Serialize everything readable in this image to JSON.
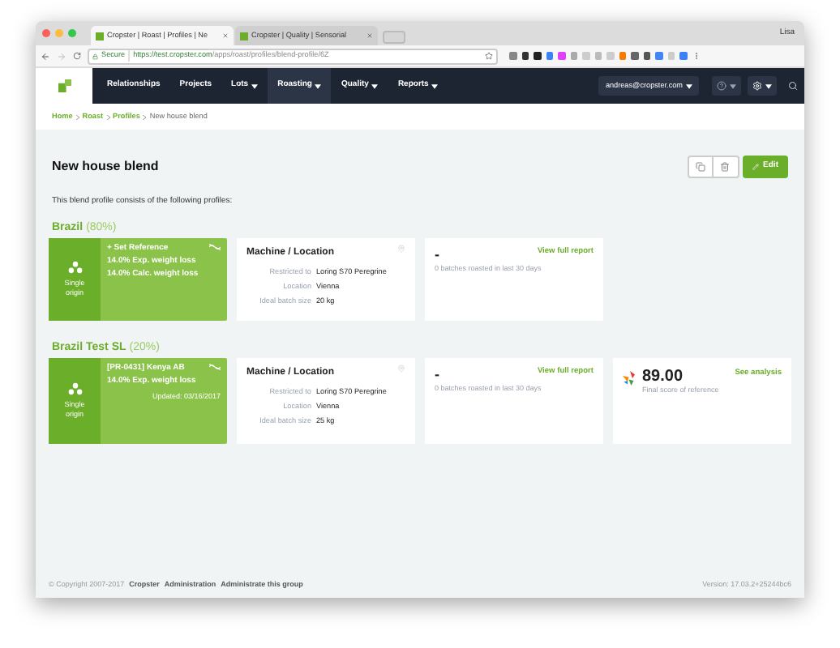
{
  "browser": {
    "tabs": [
      {
        "title": "Cropster | Roast | Profiles | Ne",
        "selected": true
      },
      {
        "title": "Cropster | Quality | Sensorial",
        "selected": false
      }
    ],
    "profile": "Lisa",
    "secure_label": "Secure",
    "url_host": "https://test.cropster.com",
    "url_path": "/apps/roast/profiles/blend-profile/6Z"
  },
  "nav": {
    "items": [
      {
        "label": "Relationships",
        "dropdown": false,
        "selected": false
      },
      {
        "label": "Projects",
        "dropdown": false,
        "selected": false
      },
      {
        "label": "Lots",
        "dropdown": true,
        "selected": false
      },
      {
        "label": "Roasting",
        "dropdown": true,
        "selected": true
      },
      {
        "label": "Quality",
        "dropdown": true,
        "selected": false
      },
      {
        "label": "Reports",
        "dropdown": true,
        "selected": false
      }
    ],
    "user": "andreas@cropster.com"
  },
  "breadcrumb": [
    "Home",
    "Roast",
    "Profiles",
    "New house blend"
  ],
  "page": {
    "title": "New house blend",
    "edit_label": "Edit",
    "description": "This blend profile consists of the following profiles:"
  },
  "components": [
    {
      "name": "Brazil",
      "share": "(80%)",
      "profile": {
        "type_label": "Single origin",
        "title": "+ Set Reference",
        "lines": [
          {
            "text": "14.0% Exp. weight loss",
            "kind": "detail"
          },
          {
            "text": "14.0% Calc. weight loss",
            "kind": "detail"
          }
        ]
      },
      "machine": {
        "title": "Machine / Location",
        "rows": [
          {
            "label": "Restricted to",
            "value": "Loring S70 Peregrine"
          },
          {
            "label": "Location",
            "value": "Vienna"
          },
          {
            "label": "Ideal batch size",
            "value": "20 kg"
          }
        ]
      },
      "batches": {
        "value": "-",
        "link": "View full report",
        "caption": "0 batches roasted in last 30 days"
      }
    },
    {
      "name": "Brazil Test SL",
      "share": "(20%)",
      "profile": {
        "type_label": "Single origin",
        "title": "[PR-0431] Kenya AB",
        "lines": [
          {
            "text": "14.0% Exp. weight loss",
            "kind": "detail"
          },
          {
            "text": "Updated: 03/16/2017",
            "kind": "date"
          }
        ]
      },
      "machine": {
        "title": "Machine / Location",
        "rows": [
          {
            "label": "Restricted to",
            "value": "Loring S70 Peregrine"
          },
          {
            "label": "Location",
            "value": "Vienna"
          },
          {
            "label": "Ideal batch size",
            "value": "25 kg"
          }
        ]
      },
      "batches": {
        "value": "-",
        "link": "View full report",
        "caption": "0 batches roasted in last 30 days"
      },
      "quality": {
        "score": "89.00",
        "link": "See analysis",
        "caption": "Final score of reference"
      }
    }
  ],
  "footer": {
    "copyright": "© Copyright 2007-2017",
    "links": [
      "Cropster",
      "Administration",
      "Administrate this group"
    ],
    "version": "Version: 17.03.2+25244bc6"
  }
}
